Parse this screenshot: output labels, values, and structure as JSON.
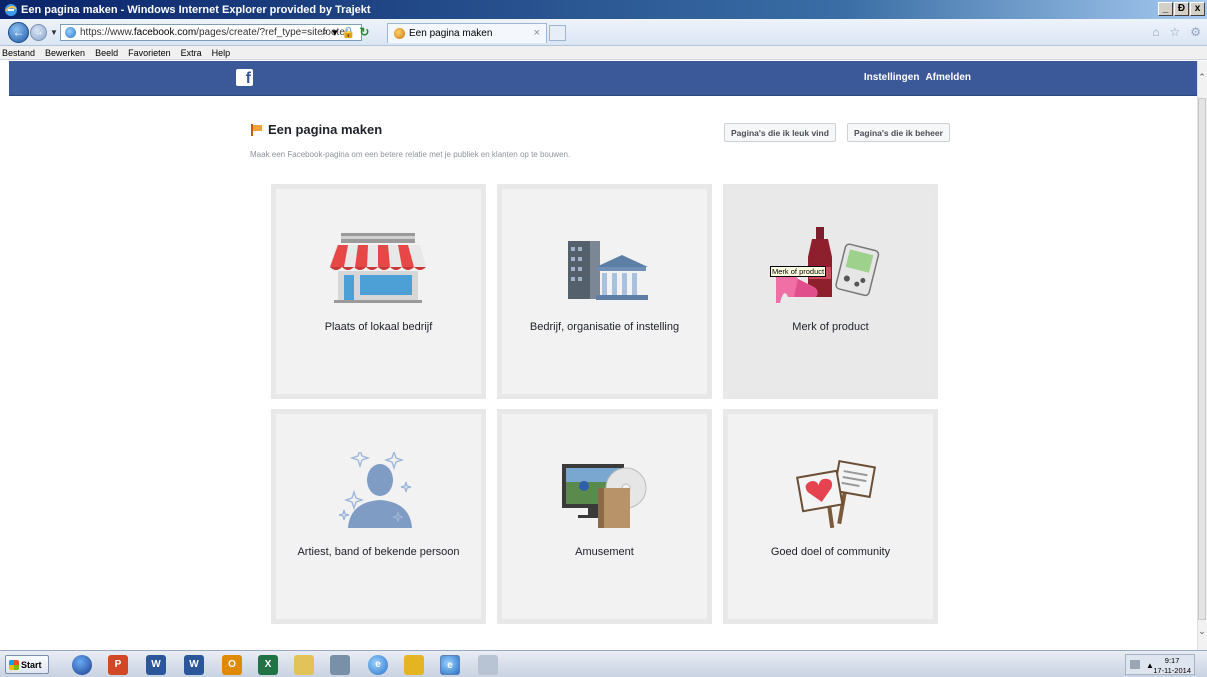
{
  "window": {
    "title": "Een pagina maken - Windows Internet Explorer provided by Trajekt",
    "controls": [
      "_",
      "Ɖ",
      "x"
    ]
  },
  "browser": {
    "address_prefix": "https://www.",
    "address_domain": "facebook.com",
    "address_path": "/pages/create/?ref_type=sitefooter",
    "search_glyph": "⌕",
    "tab_title": "Een pagina maken",
    "tab_close": "×",
    "right_tools": [
      "⌂",
      "☆",
      "⚙"
    ]
  },
  "menu": [
    "Bestand",
    "Bewerken",
    "Beeld",
    "Favorieten",
    "Extra",
    "Help"
  ],
  "facebook": {
    "logo": "f",
    "nav": [
      "Instellingen",
      "Afmelden"
    ]
  },
  "page": {
    "title": "Een pagina maken",
    "subtitle": "Maak een Facebook-pagina om een betere relatie met je publiek en klanten op te bouwen.",
    "buttons": {
      "liked": "Pagina's die ik leuk vind",
      "managed": "Pagina's die ik beheer"
    },
    "categories": [
      {
        "label": "Plaats of lokaal bedrijf",
        "icon": "storefront-icon"
      },
      {
        "label": "Bedrijf, organisatie of instelling",
        "icon": "office-building-icon"
      },
      {
        "label": "Merk of product",
        "icon": "products-icon"
      },
      {
        "label": "Artiest, band of bekende persoon",
        "icon": "person-stars-icon"
      },
      {
        "label": "Amusement",
        "icon": "entertainment-icon"
      },
      {
        "label": "Goed doel of community",
        "icon": "heart-signs-icon"
      }
    ],
    "tooltip": "Merk of product"
  },
  "taskbar": {
    "start": "Start",
    "time": "9:17",
    "date": "17-11-2014"
  }
}
